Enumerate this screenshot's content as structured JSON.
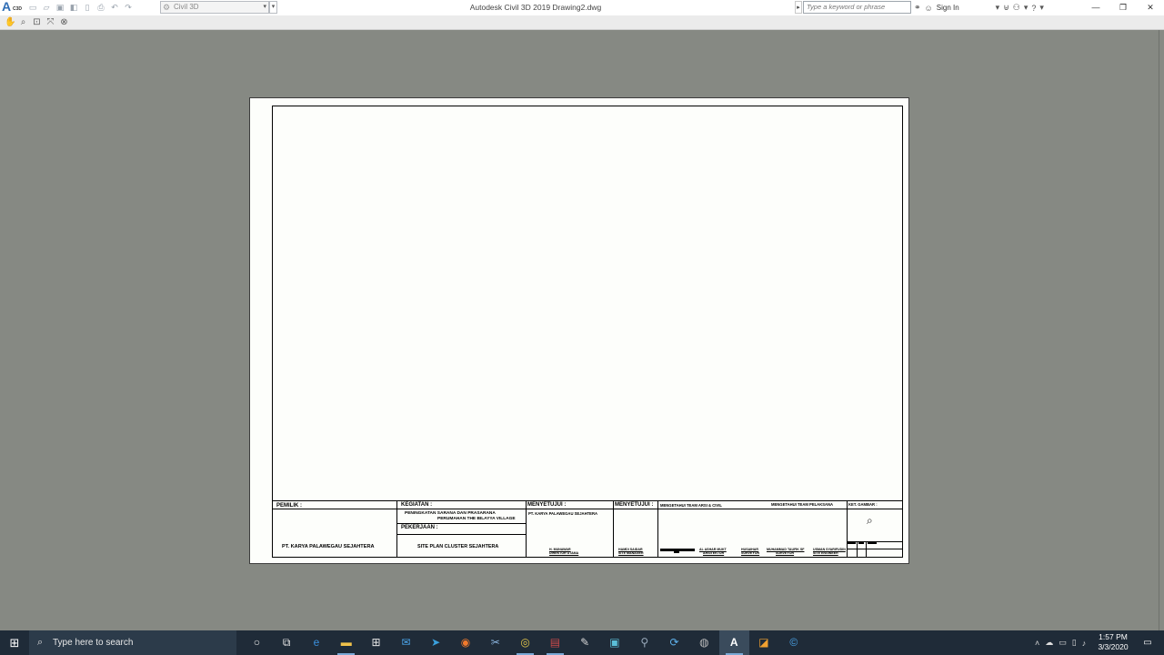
{
  "titlebar": {
    "app_label": "C3D",
    "workspace": "Civil 3D",
    "window_title": "Autodesk Civil 3D 2019   Drawing2.dwg",
    "search_placeholder": "Type a keyword or phrase",
    "sign_in": "Sign In",
    "icons": [
      "new-icon",
      "open-icon",
      "save-icon",
      "save-as-icon",
      "publish-icon",
      "plot-icon",
      "undo-icon",
      "redo-icon"
    ]
  },
  "nav_icons": [
    "pan-icon",
    "zoom-icon",
    "zoom-window-icon",
    "zoom-extents-icon",
    "close-preview-icon"
  ],
  "title_block": {
    "pemilik_label": "PEMILIK :",
    "pemilik_name": "PT. KARYA PALAWEGAU SEJAHTERA",
    "kegiatan_label": "KEGIATAN :",
    "kegiatan_line1": "PENINGKATAN SARANA DAN PRASARANA",
    "kegiatan_line2": "PERUMAHAN THE BILAYYA VILLAGE",
    "pekerjaan_label": "PEKERJAAN :",
    "pekerjaan_value": "SITE PLAN CLUSTER SEJAHTERA",
    "menyetujui1_label": "MENYETUJUI :",
    "menyetujui1_company": "PT. KARYA PALAWEGAU SEJAHTERA",
    "menyetujui1_sig_name": "H. MUNAWAR",
    "menyetujui1_sig_role": "DIREKTUR UTAMA",
    "menyetujui2_label": "MENYETUJUI :",
    "menyetujui2_sig_name": "HAMDI SAIDAR",
    "menyetujui2_sig_role": "SITE MANAGER",
    "mengetahui1_label": "MENGETAHUI TEAM ARSI & CIVIL",
    "mengetahui2_label": "MENGETAHUI TEAM PELAKSANA",
    "sig3_name": "AL ASHAR MUKT",
    "sig3_role": "ARSITEKTUR",
    "sig4_name": "HUSAIHAR",
    "sig4_role": "SURVEYOR",
    "sig5_name": "MUHAMMAD TAUFIK SF",
    "sig5_role": "SURVEYOR",
    "sig6_name": "USMAN SYARIFUDIN",
    "sig6_role": "SITE ENGINEER",
    "ket_gambar_label": "KET. GAMBAR :"
  },
  "taskbar": {
    "search_placeholder": "Type here to search",
    "time": "1:57 PM",
    "date": "3/3/2020",
    "apps": [
      "cortana-icon",
      "task-view-icon",
      "edge-icon",
      "file-explorer-icon",
      "store-icon",
      "mail-icon",
      "telegram-icon",
      "firefox-icon",
      "snipping-icon",
      "chrome-icon",
      "winrar-icon",
      "paint-icon",
      "meeting-icon",
      "network-icon",
      "sync-icon",
      "globe-icon",
      "autocad-icon",
      "orange-app-icon",
      "ccleaner-icon"
    ]
  }
}
